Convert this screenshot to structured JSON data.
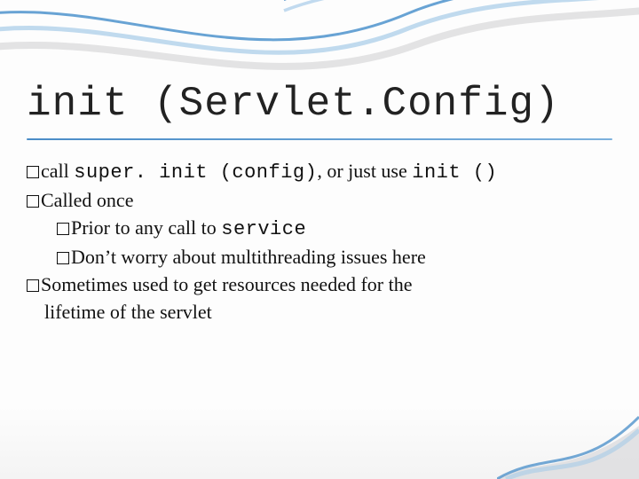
{
  "title_parts": {
    "a": "init (Servlet.",
    "b": "Config)"
  },
  "bullets": {
    "b1": {
      "t1": "call ",
      "code1": "super. init (config)",
      "t2": ", or just use ",
      "code2": "init ()"
    },
    "b2": "Called once",
    "b2_1": {
      "t1": "Prior to any call to ",
      "code1": "service"
    },
    "b2_2": "Don’t worry about multithreading issues here",
    "b3_line1": "Sometimes used to get resources needed for the",
    "b3_line2": "lifetime of the servlet"
  }
}
